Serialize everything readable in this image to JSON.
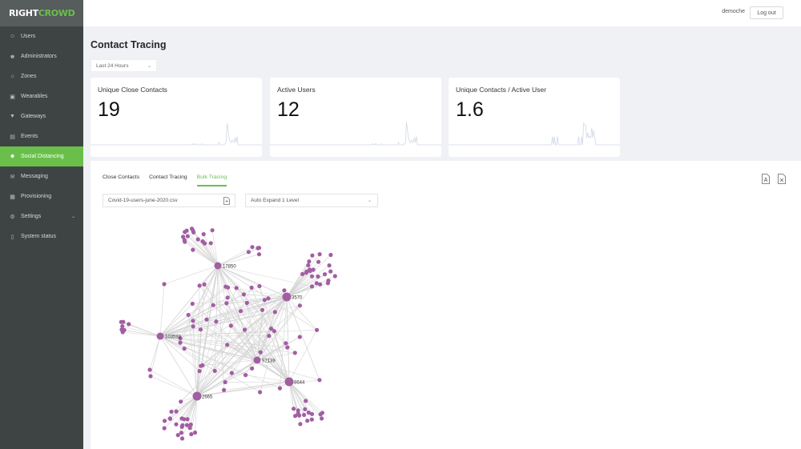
{
  "brand": {
    "part1": "RIGHT",
    "part2": "CROWD",
    "accent": "#6abf4b"
  },
  "sidebar": {
    "items": [
      {
        "label": "Users",
        "icon": "user-icon"
      },
      {
        "label": "Administrators",
        "icon": "admin-icon"
      },
      {
        "label": "Zones",
        "icon": "home-icon"
      },
      {
        "label": "Wearables",
        "icon": "wearable-icon"
      },
      {
        "label": "Gateways",
        "icon": "wifi-icon"
      },
      {
        "label": "Events",
        "icon": "events-icon"
      },
      {
        "label": "Social Distancing",
        "icon": "people-icon",
        "active": true
      },
      {
        "label": "Messaging",
        "icon": "mail-icon"
      },
      {
        "label": "Provisioning",
        "icon": "grid-icon"
      },
      {
        "label": "Settings",
        "icon": "gear-icon",
        "expandable": true
      },
      {
        "label": "System status",
        "icon": "book-icon"
      }
    ]
  },
  "header": {
    "username": "demoche",
    "logout_label": "Log out"
  },
  "page": {
    "title": "Contact Tracing",
    "time_range": "Last 24 Hours"
  },
  "cards": [
    {
      "title": "Unique Close Contacts",
      "value": "19",
      "spark": [
        0,
        0,
        0,
        0,
        0,
        0,
        0,
        0,
        0,
        0,
        0,
        0,
        0,
        0,
        0,
        0,
        0,
        0,
        0,
        0,
        0,
        0,
        0,
        0,
        0,
        0,
        0,
        0,
        0,
        0,
        0,
        0,
        0,
        0,
        0,
        0,
        0,
        0,
        0,
        0,
        0,
        0,
        0,
        0,
        0,
        0,
        0,
        0,
        0,
        0,
        0,
        0,
        0,
        0,
        0,
        0,
        0,
        0,
        0,
        0,
        0,
        0,
        0,
        0,
        0,
        0,
        0,
        0,
        0,
        0,
        0,
        0,
        0,
        0,
        0,
        0,
        0,
        0,
        0,
        0,
        0,
        0,
        0,
        0,
        0,
        0,
        0,
        0,
        0,
        0,
        0,
        0,
        0,
        0,
        0,
        0,
        0,
        0,
        0,
        0,
        0,
        0,
        0,
        0.05,
        0,
        0,
        0.05,
        0,
        0,
        0,
        0,
        0,
        0.05,
        0,
        0,
        0,
        0,
        0,
        0,
        0,
        0,
        0,
        0,
        0,
        0,
        0,
        0,
        0,
        0,
        0.1,
        0,
        0,
        0,
        0,
        0,
        0.05,
        0.1,
        0.9,
        0.6,
        0.3,
        0.15,
        0.1,
        0.2,
        0.15,
        0.1,
        0.3,
        0.1,
        0.35,
        0,
        0,
        0,
        0,
        0,
        0,
        0,
        0,
        0,
        0,
        0,
        0,
        0,
        0,
        0,
        0,
        0,
        0,
        0,
        0,
        0,
        0,
        0,
        0,
        0
      ]
    },
    {
      "title": "Active Users",
      "value": "12",
      "spark": [
        0,
        0,
        0,
        0,
        0,
        0,
        0,
        0,
        0,
        0,
        0,
        0,
        0,
        0,
        0,
        0,
        0,
        0,
        0,
        0,
        0,
        0,
        0,
        0,
        0,
        0,
        0,
        0,
        0,
        0,
        0,
        0,
        0,
        0,
        0,
        0,
        0,
        0,
        0,
        0,
        0,
        0,
        0,
        0,
        0,
        0,
        0,
        0,
        0,
        0,
        0,
        0,
        0,
        0,
        0,
        0,
        0,
        0,
        0,
        0,
        0,
        0,
        0,
        0,
        0,
        0,
        0,
        0,
        0,
        0,
        0,
        0,
        0,
        0,
        0,
        0,
        0,
        0,
        0,
        0,
        0,
        0,
        0,
        0,
        0,
        0,
        0,
        0,
        0,
        0,
        0,
        0,
        0,
        0,
        0,
        0,
        0,
        0,
        0,
        0,
        0,
        0,
        0,
        0.05,
        0,
        0,
        0.05,
        0,
        0,
        0,
        0,
        0,
        0.05,
        0,
        0,
        0,
        0,
        0,
        0,
        0,
        0,
        0,
        0,
        0,
        0,
        0,
        0,
        0,
        0,
        0.1,
        0,
        0,
        0,
        0,
        0,
        0.05,
        0.1,
        0.95,
        0.6,
        0.3,
        0.15,
        0.1,
        0.2,
        0.15,
        0.1,
        0.3,
        0.1,
        0.35,
        0,
        0,
        0,
        0,
        0,
        0,
        0,
        0,
        0,
        0,
        0,
        0,
        0,
        0,
        0,
        0,
        0,
        0,
        0,
        0,
        0,
        0,
        0,
        0,
        0
      ]
    },
    {
      "title": "Unique Contacts / Active User",
      "value": "1.6",
      "spark": [
        0,
        0,
        0,
        0,
        0,
        0,
        0,
        0,
        0,
        0,
        0,
        0,
        0,
        0,
        0,
        0,
        0,
        0,
        0,
        0,
        0,
        0,
        0,
        0,
        0,
        0,
        0,
        0,
        0,
        0,
        0,
        0,
        0,
        0,
        0,
        0,
        0,
        0,
        0,
        0,
        0,
        0,
        0,
        0,
        0,
        0,
        0,
        0,
        0,
        0,
        0,
        0,
        0,
        0,
        0,
        0,
        0,
        0,
        0,
        0,
        0,
        0,
        0,
        0,
        0,
        0,
        0,
        0,
        0,
        0,
        0,
        0,
        0,
        0,
        0,
        0,
        0,
        0,
        0,
        0,
        0,
        0,
        0,
        0,
        0,
        0,
        0,
        0,
        0,
        0,
        0,
        0,
        0,
        0,
        0,
        0,
        0,
        0,
        0,
        0,
        0,
        0,
        0,
        0.35,
        0,
        0.35,
        0,
        0,
        0.35,
        0,
        0,
        0,
        0,
        0,
        0,
        0,
        0,
        0,
        0,
        0,
        0,
        0,
        0,
        0,
        0,
        0,
        0,
        0,
        0,
        0.35,
        0,
        0,
        0.35,
        0,
        0.9,
        0.85,
        0.8,
        0.3,
        0.5,
        0.3,
        0.35,
        0.3,
        0.7,
        0.3,
        0.6,
        0.35,
        0,
        0,
        0,
        0,
        0,
        0,
        0,
        0,
        0,
        0,
        0,
        0,
        0,
        0,
        0,
        0,
        0,
        0,
        0,
        0,
        0,
        0,
        0,
        0,
        0
      ]
    }
  ],
  "panel": {
    "tabs": [
      {
        "label": "Close Contacts"
      },
      {
        "label": "Contact Tracing"
      },
      {
        "label": "Bulk Tracing",
        "active": true
      }
    ],
    "file_value": "Covid-19-users-june-2020.csv",
    "expand_value": "Auto Expand 1 Level",
    "export_pdf": "pdf-icon",
    "export_excel": "excel-icon"
  },
  "graph": {
    "node_color": "#a25ea2",
    "hubs": [
      {
        "id": "17850",
        "label": "17850"
      },
      {
        "id": "3570",
        "label": "3570"
      },
      {
        "id": "103593",
        "label": "103593"
      },
      {
        "id": "92139",
        "label": "92139"
      },
      {
        "id": "8644",
        "label": "8644"
      },
      {
        "id": "2665",
        "label": "2665"
      }
    ]
  }
}
